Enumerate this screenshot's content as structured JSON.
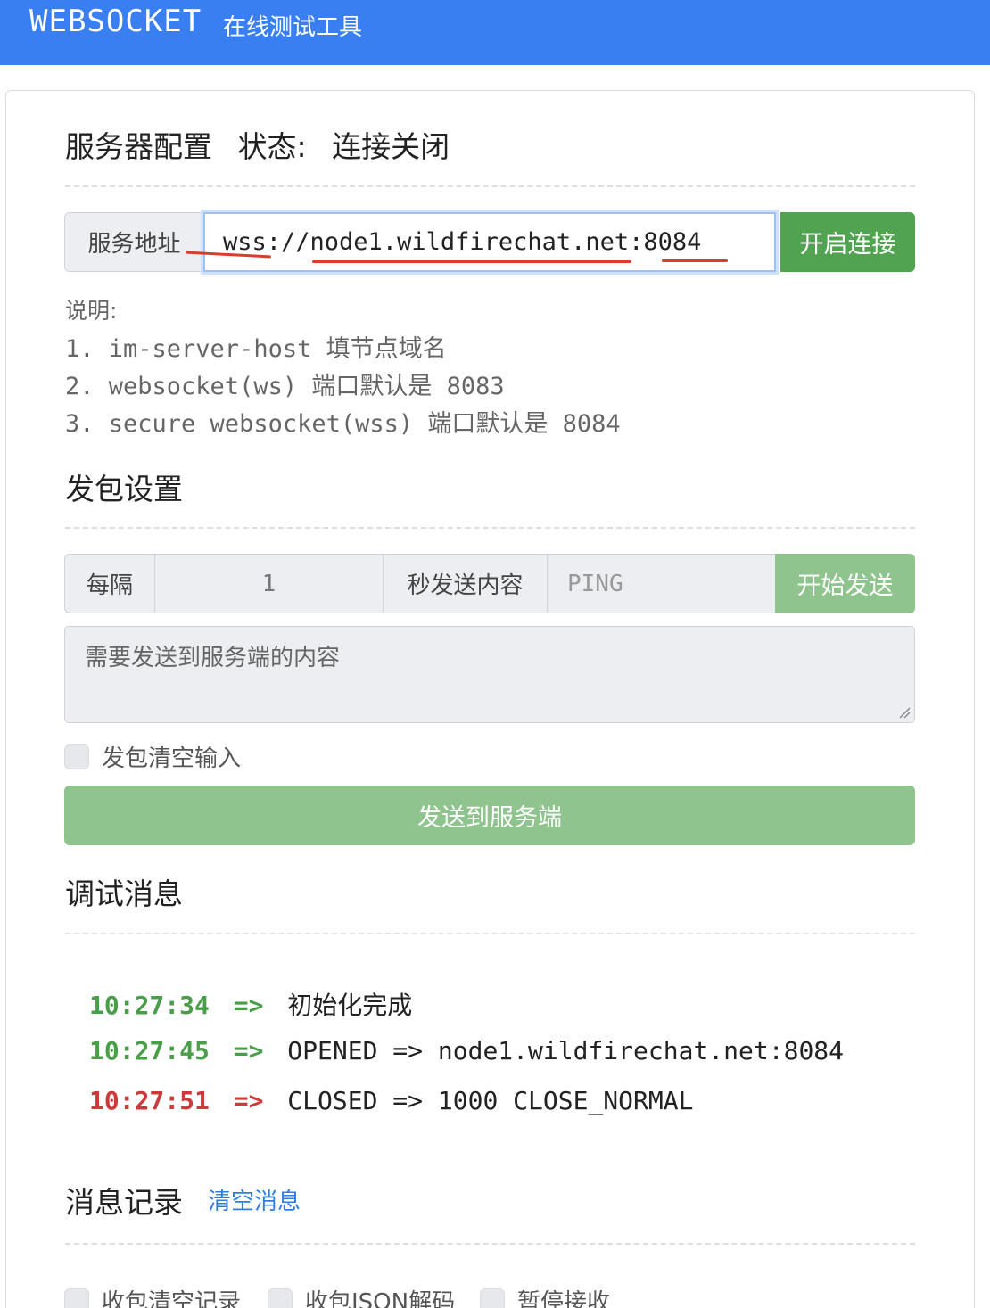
{
  "header": {
    "brand": "WEBSOCKET",
    "subtitle": "在线测试工具"
  },
  "server": {
    "title": "服务器配置",
    "status_label": "状态:",
    "status_value": "连接关闭",
    "addr_label": "服务地址",
    "addr_value": "wss://node1.wildfirechat.net:8084",
    "connect_button": "开启连接",
    "note_title": "说明:",
    "notes": [
      "1. im-server-host 填节点域名",
      "2. websocket(ws) 端口默认是 8083",
      "3. secure websocket(wss) 端口默认是 8084"
    ]
  },
  "send": {
    "title": "发包设置",
    "every_label": "每隔",
    "interval_value": "1",
    "content_label": "秒发送内容",
    "content_value": "PING",
    "start_button": "开始发送",
    "textarea_placeholder": "需要发送到服务端的内容",
    "clear_input_label": "发包清空输入",
    "send_button": "发送到服务端"
  },
  "debug": {
    "title": "调试消息",
    "lines": [
      {
        "time": "10:27:34",
        "arrow": "=>",
        "text": "初始化完成",
        "color": "#4a9e4a"
      },
      {
        "time": "10:27:45",
        "arrow": "=>",
        "text": "OPENED => node1.wildfirechat.net:8084",
        "color": "#4a9e4a"
      },
      {
        "time": "10:27:51",
        "arrow": "=>",
        "text": "CLOSED => 1000 CLOSE_NORMAL",
        "color": "#cc3b3b"
      }
    ]
  },
  "records": {
    "title": "消息记录",
    "clear_link": "清空消息",
    "options": [
      "收包清空记录",
      "收包JSON解码",
      "暂停接收"
    ]
  },
  "colors": {
    "header_blue": "#3a7ff2",
    "green": "#51a351",
    "light_green": "#8fc48e",
    "link_blue": "#2f7de1"
  }
}
